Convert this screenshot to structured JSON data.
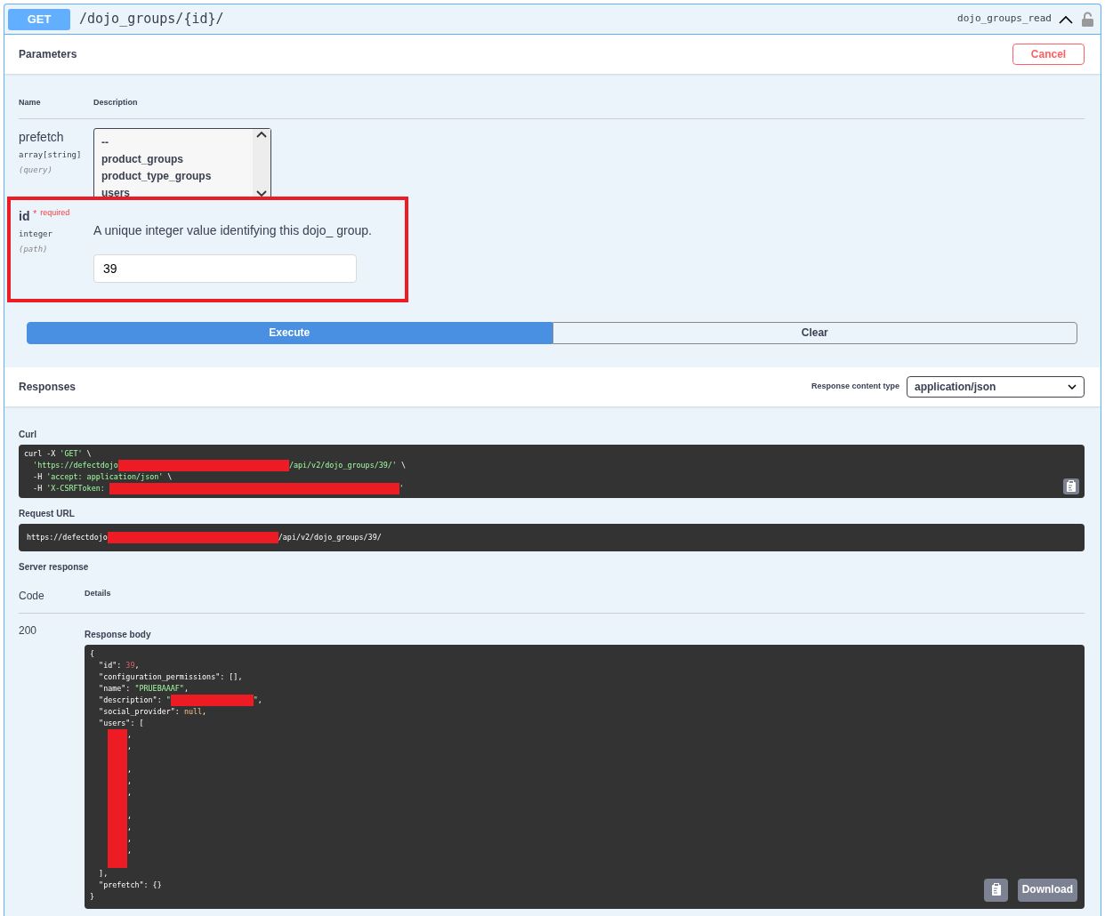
{
  "operation": {
    "method": "GET",
    "path": "/dojo_groups/{id}/",
    "operation_id": "dojo_groups_read",
    "expanded": true
  },
  "parameters": {
    "title": "Parameters",
    "cancel_button": "Cancel",
    "columns": [
      "Name",
      "Description"
    ],
    "items": [
      {
        "kind": "select",
        "name": "prefetch",
        "type": "array[string]",
        "location": "(query)",
        "options": [
          "--",
          "product_groups",
          "product_type_groups",
          "users"
        ]
      },
      {
        "kind": "input",
        "name": "id",
        "asterisk": "*",
        "required_label": "required",
        "type": "integer",
        "location": "(path)",
        "description": "A unique integer value identifying this dojo_ group.",
        "value": "39",
        "highlighted": true
      }
    ]
  },
  "actions": [
    {
      "label": "Execute",
      "kind": "primary"
    },
    {
      "label": "Clear",
      "kind": "secondary"
    }
  ],
  "responses": {
    "title": "Responses",
    "content_type_label": "Response content type",
    "content_type": "application/json",
    "curl_label": "Curl",
    "curl": [
      [
        {
          "t": "curl -X ",
          "kind": "plain"
        },
        {
          "t": "'GET'",
          "kind": "string"
        },
        {
          "t": " \\",
          "kind": "plain"
        }
      ],
      [
        {
          "t": "  'https://defectdojo",
          "kind": "string"
        },
        {
          "kind": "redacted-long"
        },
        {
          "t": "/api/v2/dojo_groups/39/'",
          "kind": "string"
        },
        {
          "t": " \\",
          "kind": "plain"
        }
      ],
      [
        {
          "t": "  -H ",
          "kind": "plain"
        },
        {
          "t": "'accept: application/json'",
          "kind": "string"
        },
        {
          "t": " \\",
          "kind": "plain"
        }
      ],
      [
        {
          "t": "  -H ",
          "kind": "plain"
        },
        {
          "t": "'X-CSRFToken: ",
          "kind": "string"
        },
        {
          "kind": "redacted-xlong"
        },
        {
          "t": "'",
          "kind": "string"
        }
      ]
    ],
    "request_url_label": "Request URL",
    "request_url": [
      {
        "t": "https://defectdojo",
        "kind": "plain"
      },
      {
        "kind": "redacted-long"
      },
      {
        "t": "/api/v2/dojo_groups/39/",
        "kind": "plain"
      }
    ],
    "server_response_label": "Server response",
    "columns": [
      "Code",
      "Details"
    ],
    "code": "200",
    "body_label": "Response body",
    "body": [
      [
        {
          "t": "{",
          "kind": "plain"
        }
      ],
      [
        {
          "t": "  \"id\": ",
          "kind": "plain"
        },
        {
          "t": "39",
          "kind": "number"
        },
        {
          "t": ",",
          "kind": "plain"
        }
      ],
      [
        {
          "t": "  \"configuration_permissions\": [],",
          "kind": "plain"
        }
      ],
      [
        {
          "t": "  \"name\": ",
          "kind": "plain"
        },
        {
          "t": "\"PRUEBAAAF\"",
          "kind": "string"
        },
        {
          "t": ",",
          "kind": "plain"
        }
      ],
      [
        {
          "t": "  \"description\": ",
          "kind": "plain"
        },
        {
          "t": "\"",
          "kind": "string"
        },
        {
          "kind": "redacted-short"
        },
        {
          "t": "\"",
          "kind": "string"
        },
        {
          "t": ",",
          "kind": "plain"
        }
      ],
      [
        {
          "t": "  \"social_provider\": ",
          "kind": "plain"
        },
        {
          "t": "null",
          "kind": "null"
        },
        {
          "t": ",",
          "kind": "plain"
        }
      ],
      [
        {
          "t": "  \"users\": [",
          "kind": "plain"
        }
      ],
      [
        {
          "kind": "userlist"
        }
      ],
      [
        {
          "t": "  ],",
          "kind": "plain"
        }
      ],
      [
        {
          "t": "  \"prefetch\": {}",
          "kind": "plain"
        }
      ],
      [
        {
          "t": "}",
          "kind": "plain"
        }
      ]
    ],
    "users": [
      {
        "kind": "entry",
        "suffix": ","
      },
      {
        "kind": "entry",
        "suffix": ","
      },
      {
        "kind": "blank"
      },
      {
        "kind": "entry",
        "suffix": ","
      },
      {
        "kind": "entry",
        "suffix": ","
      },
      {
        "kind": "entry",
        "suffix": ","
      },
      {
        "kind": "blank"
      },
      {
        "kind": "entry",
        "suffix": ","
      },
      {
        "kind": "entry",
        "suffix": ","
      },
      {
        "kind": "entry",
        "suffix": ","
      },
      {
        "kind": "entry",
        "suffix": ","
      },
      {
        "kind": "blank"
      }
    ],
    "download_button": "Download"
  }
}
